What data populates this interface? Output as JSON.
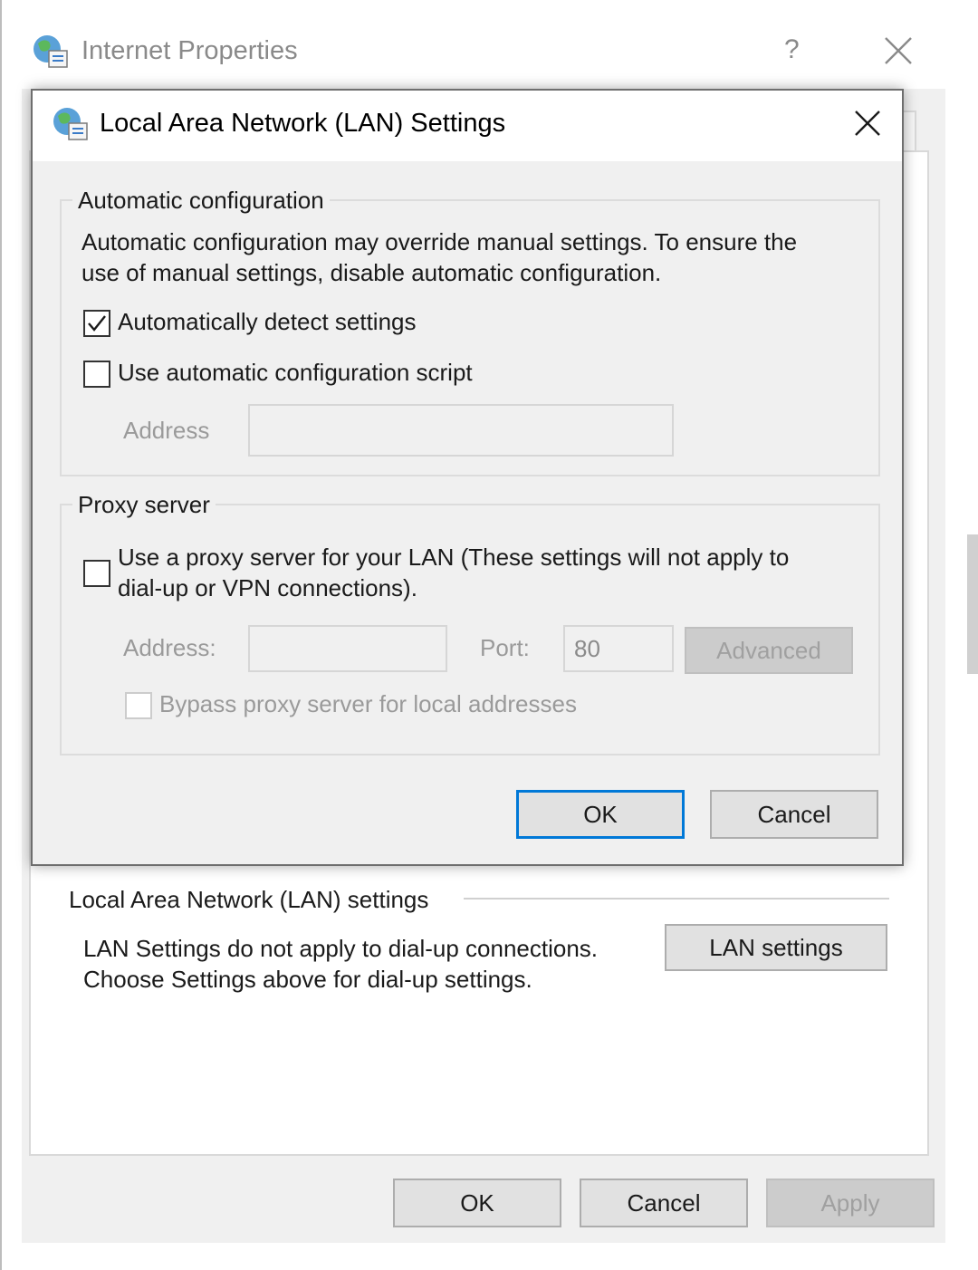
{
  "outer_window": {
    "title": "Internet Properties",
    "help_glyph": "?",
    "lan_group": {
      "label": "Local Area Network (LAN) settings",
      "description_line1": "LAN Settings do not apply to dial-up connections.",
      "description_line2": "Choose Settings above for dial-up settings.",
      "button_label": "LAN settings"
    },
    "buttons": {
      "ok": "OK",
      "cancel": "Cancel",
      "apply": "Apply"
    }
  },
  "dialog": {
    "title": "Local Area Network (LAN) Settings",
    "auto_config": {
      "label": "Automatic configuration",
      "description_line1": "Automatic configuration may override manual settings.  To ensure the",
      "description_line2": "use of manual settings, disable automatic configuration.",
      "auto_detect_label": "Automatically detect settings",
      "auto_detect_checked": true,
      "use_script_label": "Use automatic configuration script",
      "use_script_checked": false,
      "address_label": "Address",
      "address_value": ""
    },
    "proxy": {
      "label": "Proxy server",
      "use_proxy_label_line1": "Use a proxy server for your LAN (These settings will not apply to",
      "use_proxy_label_line2": "dial-up or VPN connections).",
      "use_proxy_checked": false,
      "address_label": "Address:",
      "address_value": "",
      "port_label": "Port:",
      "port_value": "80",
      "advanced_label": "Advanced",
      "bypass_label": "Bypass proxy server for local addresses",
      "bypass_checked": false
    },
    "buttons": {
      "ok": "OK",
      "cancel": "Cancel"
    }
  },
  "icons": {
    "window_icon": "globe-network-icon",
    "close": "close-icon",
    "checkmark": "checkmark-icon"
  },
  "colors": {
    "dialog_background": "#f0f0f0",
    "focus_border": "#0078d7",
    "disabled_text": "#9a9a9a"
  }
}
